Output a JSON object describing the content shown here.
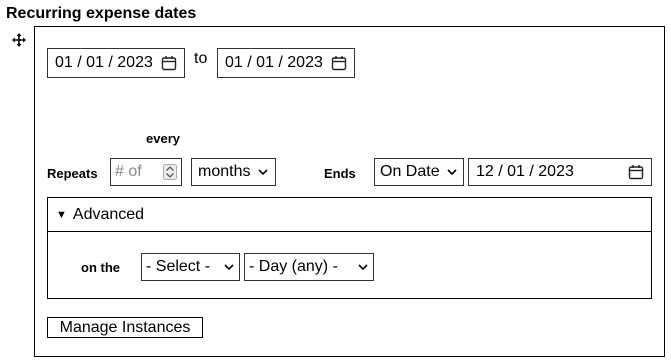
{
  "title": "Recurring expense dates",
  "icons": {
    "move": "move-icon",
    "calendar": "calendar-icon",
    "spinner": "spinner-icon",
    "chevron": "chevron-down-icon",
    "disclosure": "disclosure-triangle-icon"
  },
  "range": {
    "start_date": "01 / 01 / 2023",
    "to_label": "to",
    "end_date": "01 / 01 / 2023"
  },
  "repeat": {
    "every_label": "every",
    "repeats_label": "Repeats",
    "count_placeholder": "# of",
    "unit_value": "months",
    "ends_label": "Ends",
    "ends_value": "On Date",
    "ends_date": "12 / 01 / 2023"
  },
  "advanced": {
    "summary": "Advanced",
    "on_the_label": "on the",
    "select1_value": "- Select -",
    "select2_value": "- Day (any) -"
  },
  "manage_button": "Manage Instances"
}
